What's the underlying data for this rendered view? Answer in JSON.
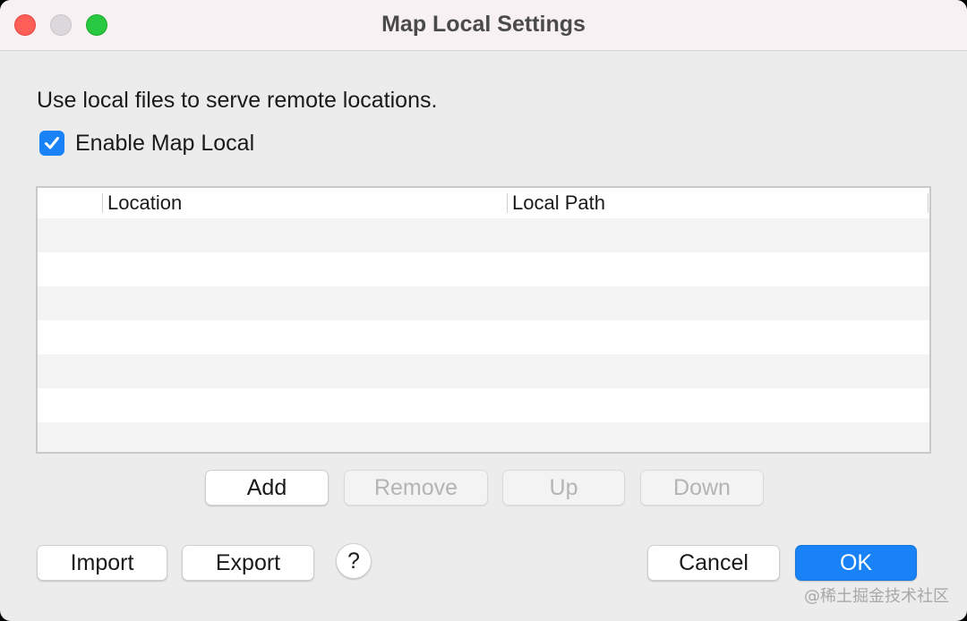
{
  "window": {
    "title": "Map Local Settings"
  },
  "description": "Use local files to serve remote locations.",
  "enable_checkbox": {
    "label": "Enable Map Local",
    "checked": true
  },
  "table": {
    "columns": [
      "",
      "Location",
      "Local Path"
    ],
    "rows": []
  },
  "table_buttons": {
    "add": "Add",
    "remove": "Remove",
    "up": "Up",
    "down": "Down"
  },
  "footer": {
    "import": "Import",
    "export": "Export",
    "help": "?",
    "cancel": "Cancel",
    "ok": "OK"
  },
  "watermark": "@稀土掘金技术社区",
  "colors": {
    "accent": "#1a82f7",
    "close": "#ff5f57",
    "maximize": "#28c840"
  }
}
